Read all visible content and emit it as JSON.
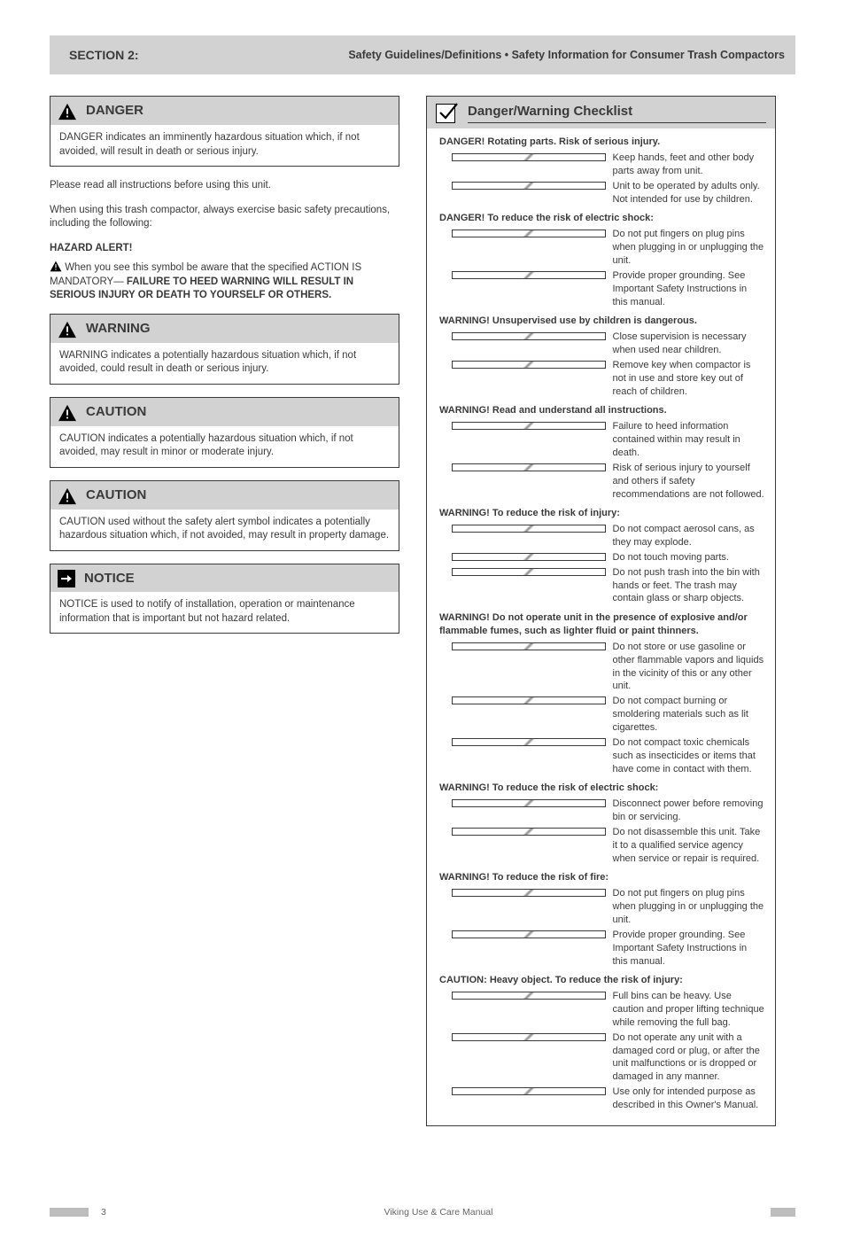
{
  "title_bar": {
    "section": "SECTION 2:",
    "bullets": "Safety Guidelines/Definitions • Safety Information for Consumer Trash Compactors"
  },
  "left": {
    "danger": {
      "header": "DANGER",
      "body": "DANGER indicates an imminently hazardous situation which, if not avoided, will result in death or serious injury."
    },
    "intro1": "Please read all instructions before using this unit.",
    "intro2": "When using this trash compactor, always exercise basic safety precautions, including the following:",
    "hazard_heading": "HAZARD ALERT!",
    "hazard_body_prefix": "    When you see this symbol be aware that the specified ACTION IS MANDATORY—",
    "hazard_body_bold": " FAILURE TO HEED WARNING WILL RESULT IN SERIOUS INJURY OR DEATH TO YOURSELF OR OTHERS.",
    "warning": {
      "header": "WARNING",
      "body": "WARNING indicates a potentially hazardous situation which, if not avoided, could result in death or serious injury."
    },
    "caution1": {
      "header": "CAUTION",
      "body": "CAUTION indicates a potentially hazardous situation which, if not avoided, may result in minor or moderate injury."
    },
    "caution2": {
      "header": "CAUTION",
      "body": "CAUTION used without the safety alert symbol indicates a potentially hazardous situation which, if not avoided, may result in property damage."
    },
    "notice": {
      "header": "NOTICE",
      "body": "NOTICE is used to notify of installation, operation or maintenance information that is important but not hazard related."
    }
  },
  "checklist": {
    "title": "Danger/Warning Checklist",
    "groups": [
      {
        "title": "DANGER! Rotating parts. Risk of serious injury.",
        "items": [
          "Keep hands, feet and other body parts away from unit.",
          "Unit to be operated by adults only. Not intended for use by children."
        ]
      },
      {
        "title": "DANGER! To reduce the risk of electric shock:",
        "items": [
          "Do not put fingers on plug pins when plugging in or unplugging the unit.",
          "Provide proper grounding. See Important Safety Instructions in this manual."
        ]
      },
      {
        "title": "WARNING! Unsupervised use by children is dangerous.",
        "items": [
          "Close supervision is necessary when used near children.",
          "Remove key when compactor is not in use and store key out of reach of children."
        ]
      },
      {
        "title": "WARNING! Read and understand all instructions.",
        "items": [
          "Failure to heed information contained within may result in death.",
          "Risk of serious injury to yourself and others if safety recommendations are not followed."
        ]
      },
      {
        "title": "WARNING! To reduce the risk of injury:",
        "items": [
          "Do not compact aerosol cans, as they may explode.",
          "Do not touch moving parts.",
          "Do not push trash into the bin with hands or feet. The trash may contain glass or sharp objects."
        ]
      },
      {
        "title": "WARNING! Do not operate unit in the presence of explosive and/or flammable fumes, such as lighter fluid or paint thinners.",
        "items": [
          "Do not store or use gasoline or other flammable vapors and liquids in the vicinity of this or any other unit.",
          "Do not compact burning or smoldering materials such as lit cigarettes.",
          "Do not compact toxic chemicals such as insecticides or items that have come in contact with them."
        ]
      },
      {
        "title": "WARNING! To reduce the risk of electric shock:",
        "items": [
          "Disconnect power before removing bin or servicing.",
          "Do not disassemble this unit. Take it to a qualified service agency when service or repair is required."
        ]
      },
      {
        "title": "WARNING! To reduce the risk of fire:",
        "items": [
          "Do not put fingers on plug pins when plugging in or unplugging the unit.",
          "Provide proper grounding. See Important Safety Instructions in this manual."
        ]
      },
      {
        "title": "CAUTION: Heavy object. To reduce the risk of injury:",
        "items": [
          "Full bins can be heavy. Use caution and proper lifting technique while removing the full bag.",
          "Do not operate any unit with a damaged cord or plug, or after the unit malfunctions or is dropped or damaged in any manner.",
          "Use only for intended purpose as described in this Owner's Manual."
        ]
      }
    ]
  },
  "footer": {
    "page": "3",
    "text": "Viking Use & Care Manual"
  }
}
